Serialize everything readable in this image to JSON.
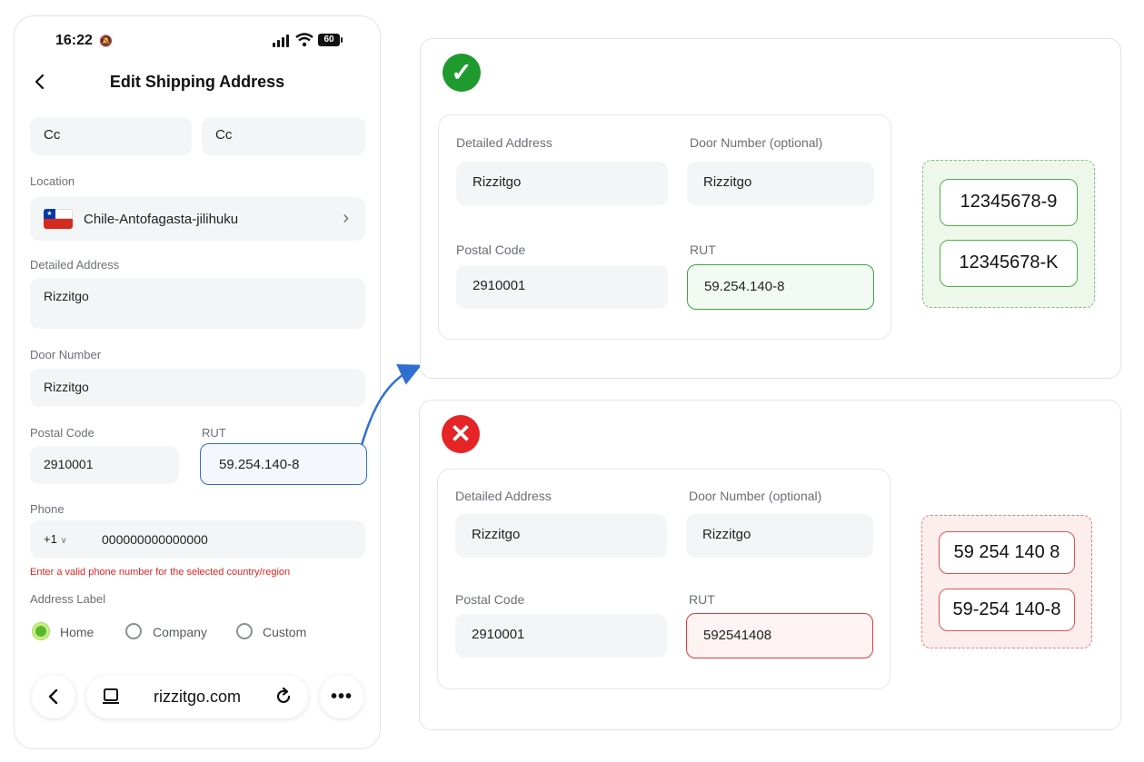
{
  "status": {
    "time": "16:22",
    "battery": "60"
  },
  "header": {
    "title": "Edit Shipping Address"
  },
  "name": {
    "first": "Cc",
    "last": "Cc"
  },
  "location": {
    "label": "Location",
    "value": "Chile-Antofagasta-jilihuku"
  },
  "detailed": {
    "label": "Detailed Address",
    "value": "Rizzitgo"
  },
  "door": {
    "label": "Door Number",
    "value": "Rizzitgo"
  },
  "postal": {
    "label": "Postal Code",
    "value": "2910001"
  },
  "rut": {
    "label": "RUT",
    "value": "59.254.140-8"
  },
  "phone": {
    "label": "Phone",
    "code": "+1",
    "number": "000000000000000",
    "error": "Enter a valid phone number for the selected country/region"
  },
  "address_label": {
    "label": "Address Label",
    "options": [
      "Home",
      "Company",
      "Custom"
    ],
    "selected": "Home"
  },
  "browser": {
    "url": "rizzitgo.com"
  },
  "valid_example": {
    "detailed_label": "Detailed Address",
    "detailed_value": "Rizzitgo",
    "door_label": "Door Number (optional)",
    "door_value": "Rizzitgo",
    "postal_label": "Postal Code",
    "postal_value": "2910001",
    "rut_label": "RUT",
    "rut_value": "59.254.140-8",
    "samples": [
      "12345678-9",
      "12345678-K"
    ]
  },
  "invalid_example": {
    "detailed_label": "Detailed Address",
    "detailed_value": "Rizzitgo",
    "door_label": "Door Number (optional)",
    "door_value": "Rizzitgo",
    "postal_label": "Postal Code",
    "postal_value": "2910001",
    "rut_label": "RUT",
    "rut_value": "592541408",
    "samples": [
      "59 254 140 8",
      "59-254 140-8"
    ]
  },
  "colors": {
    "accent_blue": "#2f6fd1",
    "ok_green": "#1f9a2e",
    "error_red": "#e52525"
  }
}
